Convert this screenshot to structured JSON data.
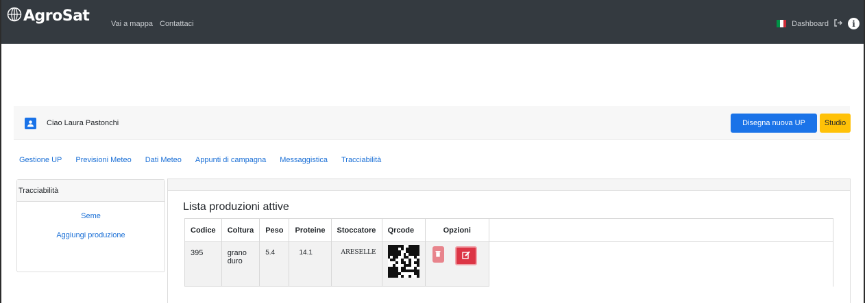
{
  "navbar": {
    "brand": "AgroSat",
    "links": [
      "Vai a mappa",
      "Contattaci"
    ],
    "dashboard_label": "Dashboard",
    "flag_colors": [
      "#009246",
      "#ffffff",
      "#ce2b37"
    ]
  },
  "userbar": {
    "greeting": "Ciao Laura Pastonchi",
    "draw_button": "Disegna nuova UP",
    "study_button": "Studio"
  },
  "tabs": [
    "Gestione UP",
    "Previsioni Meteo",
    "Dati Meteo",
    "Appunti di campagna",
    "Messaggistica",
    "Tracciabilità"
  ],
  "sidebar": {
    "title": "Tracciabilità",
    "items": [
      "Seme",
      "Aggiungi produzione"
    ]
  },
  "main": {
    "title": "Lista produzioni attive",
    "columns": [
      "Codice",
      "Coltura",
      "Peso",
      "Proteine",
      "Stoccatore",
      "Qrcode",
      "Opzioni"
    ],
    "rows": [
      {
        "codice": "395",
        "coltura": "grano duro",
        "peso": "5.4",
        "proteine": "14.1",
        "stoccatore": "ARESELLE"
      }
    ]
  },
  "colors": {
    "navbar_bg": "#343a40",
    "primary": "#1a73e8",
    "warning": "#ffc107",
    "danger": "#dc3545",
    "link": "#1a6fd6"
  }
}
